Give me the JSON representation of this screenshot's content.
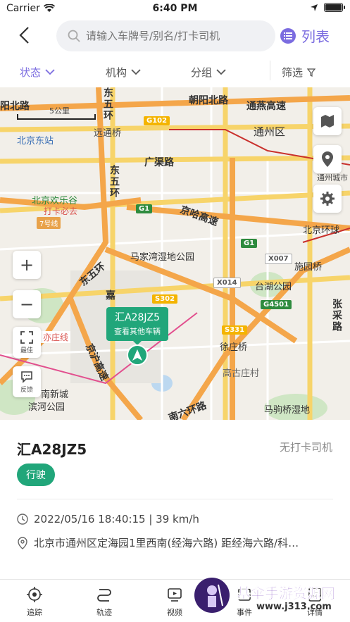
{
  "status_bar": {
    "carrier": "Carrier",
    "time": "6:40 PM"
  },
  "nav": {
    "search_placeholder": "请输入车牌号/别名/打卡司机",
    "list_label": "列表"
  },
  "filters": {
    "status": "状态",
    "org": "机构",
    "group": "分组",
    "filter": "筛选"
  },
  "map": {
    "labels": {
      "chaoyang_north": "阳北路",
      "scale": "5公里",
      "dongwuhuan_top": "东五环",
      "chaoyang_north_road": "朝阳北路",
      "tongyan": "通燕高速",
      "yuanjing": "远通桥",
      "tongzhou": "通州区",
      "beijing_east": "北京东站",
      "guangqu": "广渠路",
      "dongwuhuan": "东五环",
      "happy_valley": "北京欢乐谷",
      "must_go": "打卡必去",
      "line7": "7号线",
      "jingha": "京哈高速",
      "majiawan": "马家湾湿地公园",
      "beijing_ring": "北京环球",
      "dongsihuan": "东五环",
      "shijiqiao": "施园桥",
      "taihu": "台湖公园",
      "zhangcai": "张采路",
      "jiahu": "嘉",
      "yizhuang": "亦庄线",
      "jinghu": "京沪高速",
      "xudian": "徐庄桥",
      "gaogu": "高古庄村",
      "nanxin": "南新城",
      "binhe": "滨河公园",
      "majuqiao": "马驹桥湿地",
      "nanliu": "南六环路",
      "tongzhou_city": "通州城市"
    },
    "shields": {
      "g102": "G102",
      "g1a": "G1",
      "g1b": "G1",
      "x007": "X007",
      "x014": "X014",
      "s302": "S302",
      "g4501": "G4501",
      "s331": "S331"
    },
    "controls": {
      "zoom_in": "+",
      "zoom_out": "−",
      "best": "最佳",
      "feedback": "反馈"
    },
    "popup": {
      "plate": "汇A28JZ5",
      "sub": "查看其他车辆"
    }
  },
  "vehicle": {
    "plate": "汇A28JZ5",
    "driver_status": "无打卡司机",
    "badge": "行驶",
    "time_speed": "2022/05/16 18:40:15 | 39 km/h",
    "address": "北京市通州区定海园1里西南(经海六路) 距经海六路/科…"
  },
  "tabs": {
    "track": "追踪",
    "trajectory": "轨迹",
    "video": "视频",
    "event": "事件",
    "detail": "详情"
  },
  "watermark": {
    "title": "基伞手游资源网",
    "url": "www.j313.com"
  },
  "colors": {
    "accent": "#7b6ce0",
    "green": "#21a67a"
  }
}
